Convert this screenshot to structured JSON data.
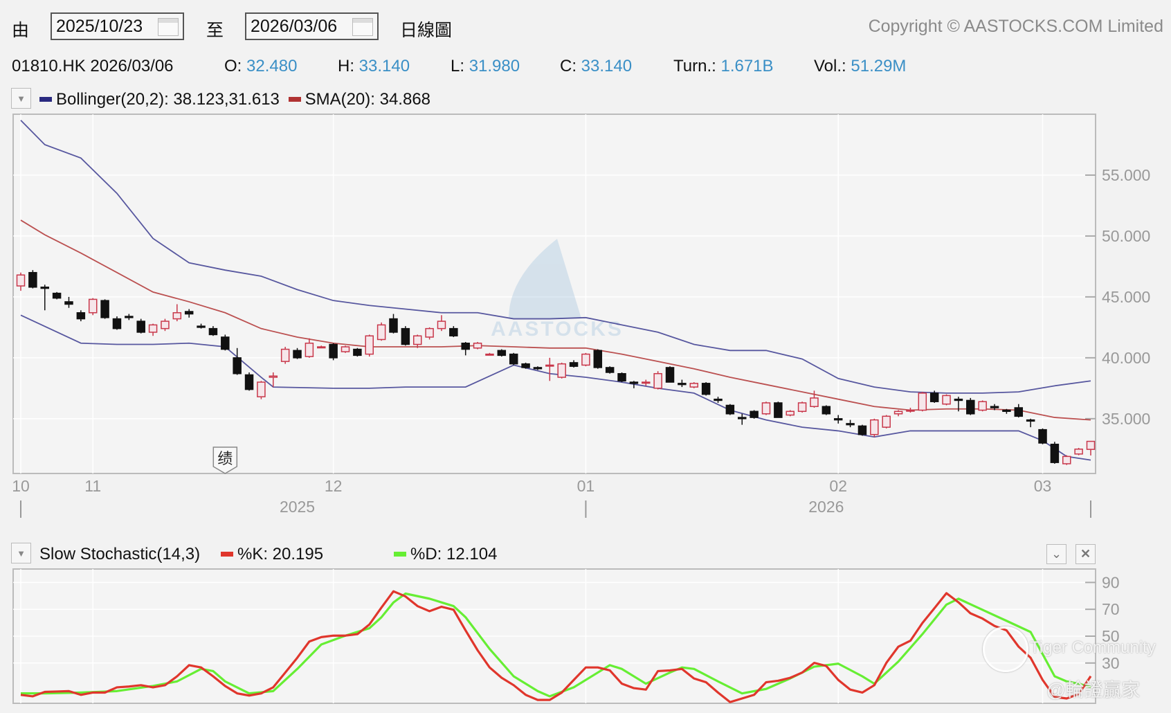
{
  "toolbar": {
    "from_label": "由",
    "from_date": "2025/10/23",
    "to_label": "至",
    "to_date": "2026/03/06",
    "chart_type": "日線圖",
    "copyright": "Copyright © AASTOCKS.COM Limited"
  },
  "quote": {
    "symbol_date": "01810.HK 2026/03/06",
    "open_label": "O:",
    "open": "32.480",
    "high_label": "H:",
    "high": "33.140",
    "low_label": "L:",
    "low": "31.980",
    "close_label": "C:",
    "close": "33.140",
    "turn_label": "Turn.:",
    "turn": "1.671B",
    "vol_label": "Vol.:",
    "vol": "51.29M"
  },
  "main_legend": {
    "bollinger": "Bollinger(20,2): 38.123,31.613",
    "sma": "SMA(20): 34.868",
    "bollinger_color": "#3b3b8f",
    "sma_color": "#b03232"
  },
  "watermark": "AASTOCKS",
  "event_marker": {
    "label": "绩",
    "index": 17
  },
  "stoch_legend": {
    "title": "Slow Stochastic(14,3)",
    "k": "%K: 20.195",
    "d": "%D: 12.104",
    "k_color": "#e0362c",
    "d_color": "#66ee33"
  },
  "overlay_watermarks": {
    "tiger": "Tiger Community",
    "author": "@輪證贏家"
  },
  "chart_data": [
    {
      "type": "candlestick",
      "title": "01810.HK Daily",
      "ylim": [
        30.5,
        60.0
      ],
      "y_ticks": [
        {
          "value": 35,
          "label": "35.000"
        },
        {
          "value": 40,
          "label": "40.000"
        },
        {
          "value": 45,
          "label": "45.000"
        },
        {
          "value": 50,
          "label": "50.000"
        },
        {
          "value": 55,
          "label": "55.000"
        }
      ],
      "month_ticks": [
        {
          "index": 0,
          "label": "10"
        },
        {
          "index": 6,
          "label": "11"
        },
        {
          "index": 26,
          "label": "12"
        },
        {
          "index": 47,
          "label": "01"
        },
        {
          "index": 68,
          "label": "02"
        },
        {
          "index": 85,
          "label": "03"
        }
      ],
      "year_ticks": [
        {
          "index": 23,
          "label": "2025"
        },
        {
          "index": 67,
          "label": "2026"
        }
      ],
      "ohlc": [
        [
          45.9,
          47.0,
          45.5,
          46.8
        ],
        [
          47.0,
          47.2,
          45.7,
          45.8
        ],
        [
          45.8,
          46.0,
          43.9,
          45.7
        ],
        [
          45.3,
          45.4,
          44.8,
          44.9
        ],
        [
          44.6,
          45.0,
          44.1,
          44.4
        ],
        [
          43.7,
          43.9,
          43.0,
          43.2
        ],
        [
          43.7,
          44.9,
          43.5,
          44.8
        ],
        [
          44.7,
          44.8,
          43.2,
          43.3
        ],
        [
          43.2,
          43.4,
          42.3,
          42.4
        ],
        [
          43.4,
          43.6,
          43.1,
          43.3
        ],
        [
          43.0,
          43.2,
          42.0,
          42.1
        ],
        [
          42.1,
          42.8,
          41.8,
          42.7
        ],
        [
          42.4,
          43.2,
          42.2,
          43.0
        ],
        [
          43.2,
          44.4,
          43.0,
          43.7
        ],
        [
          43.8,
          44.0,
          43.3,
          43.6
        ],
        [
          42.6,
          42.8,
          42.4,
          42.5
        ],
        [
          42.4,
          42.6,
          41.8,
          41.9
        ],
        [
          41.7,
          41.9,
          40.6,
          40.7
        ],
        [
          40.0,
          40.8,
          38.6,
          38.7
        ],
        [
          38.6,
          38.8,
          37.3,
          37.4
        ],
        [
          36.8,
          38.1,
          36.6,
          38.0
        ],
        [
          38.4,
          38.8,
          37.6,
          38.5
        ],
        [
          39.7,
          40.9,
          39.5,
          40.7
        ],
        [
          40.6,
          40.8,
          39.9,
          40.0
        ],
        [
          40.1,
          41.6,
          40.0,
          41.2
        ],
        [
          40.9,
          41.0,
          40.8,
          40.9
        ],
        [
          41.1,
          41.2,
          39.8,
          40.0
        ],
        [
          40.5,
          41.0,
          40.4,
          40.9
        ],
        [
          40.7,
          40.8,
          40.1,
          40.2
        ],
        [
          40.3,
          41.9,
          40.1,
          41.8
        ],
        [
          41.5,
          42.9,
          41.4,
          42.7
        ],
        [
          43.2,
          43.6,
          42.0,
          42.1
        ],
        [
          42.4,
          42.6,
          41.0,
          41.1
        ],
        [
          41.1,
          41.9,
          40.8,
          41.8
        ],
        [
          41.7,
          42.5,
          41.5,
          42.4
        ],
        [
          42.4,
          43.5,
          42.2,
          43.0
        ],
        [
          42.4,
          42.6,
          41.7,
          41.8
        ],
        [
          41.2,
          41.3,
          40.2,
          40.7
        ],
        [
          40.8,
          41.3,
          40.7,
          41.2
        ],
        [
          40.3,
          40.4,
          40.2,
          40.3
        ],
        [
          40.6,
          40.7,
          40.1,
          40.2
        ],
        [
          40.3,
          40.4,
          39.4,
          39.5
        ],
        [
          39.5,
          39.6,
          39.1,
          39.2
        ],
        [
          39.2,
          39.3,
          39.0,
          39.1
        ],
        [
          39.4,
          40.0,
          38.1,
          39.4
        ],
        [
          38.4,
          39.6,
          38.3,
          39.5
        ],
        [
          39.6,
          39.8,
          39.2,
          39.3
        ],
        [
          39.4,
          40.4,
          39.3,
          40.3
        ],
        [
          40.6,
          40.7,
          39.1,
          39.2
        ],
        [
          39.2,
          39.3,
          38.7,
          38.8
        ],
        [
          38.7,
          38.8,
          38.0,
          38.1
        ],
        [
          38.0,
          38.1,
          37.5,
          37.9
        ],
        [
          38.0,
          38.2,
          37.7,
          38.0
        ],
        [
          37.5,
          38.9,
          37.4,
          38.7
        ],
        [
          39.2,
          39.3,
          38.0,
          38.0
        ],
        [
          37.9,
          38.2,
          37.6,
          37.8
        ],
        [
          37.6,
          38.0,
          37.5,
          37.9
        ],
        [
          37.9,
          38.0,
          36.9,
          37.0
        ],
        [
          36.6,
          36.8,
          36.3,
          36.5
        ],
        [
          36.1,
          36.2,
          35.3,
          35.4
        ],
        [
          35.1,
          35.4,
          34.5,
          35.0
        ],
        [
          35.6,
          35.7,
          35.0,
          35.1
        ],
        [
          35.4,
          36.4,
          35.3,
          36.3
        ],
        [
          36.3,
          36.4,
          35.1,
          35.1
        ],
        [
          35.3,
          35.7,
          35.2,
          35.6
        ],
        [
          35.6,
          36.4,
          35.5,
          36.3
        ],
        [
          36.0,
          37.3,
          35.9,
          36.7
        ],
        [
          36.0,
          36.1,
          35.3,
          35.4
        ],
        [
          35.0,
          35.3,
          34.6,
          34.9
        ],
        [
          34.6,
          34.9,
          34.3,
          34.5
        ],
        [
          34.4,
          34.5,
          33.6,
          33.7
        ],
        [
          33.7,
          35.0,
          33.5,
          34.9
        ],
        [
          34.3,
          35.3,
          34.2,
          35.2
        ],
        [
          35.4,
          35.7,
          35.2,
          35.6
        ],
        [
          35.7,
          35.9,
          35.5,
          35.7
        ],
        [
          35.7,
          37.2,
          35.6,
          37.1
        ],
        [
          37.1,
          37.3,
          36.3,
          36.4
        ],
        [
          36.2,
          37.0,
          36.1,
          36.9
        ],
        [
          36.6,
          36.8,
          35.6,
          36.5
        ],
        [
          36.5,
          36.7,
          35.3,
          35.4
        ],
        [
          35.7,
          36.5,
          35.6,
          36.4
        ],
        [
          36.0,
          36.2,
          35.7,
          35.9
        ],
        [
          35.7,
          35.8,
          35.4,
          35.6
        ],
        [
          35.9,
          36.2,
          35.1,
          35.2
        ],
        [
          34.9,
          35.0,
          34.3,
          34.8
        ],
        [
          34.1,
          34.2,
          32.9,
          33.0
        ],
        [
          32.9,
          33.1,
          31.3,
          31.4
        ],
        [
          31.3,
          32.0,
          31.2,
          31.9
        ],
        [
          32.1,
          32.6,
          32.0,
          32.5
        ],
        [
          32.48,
          33.14,
          31.98,
          33.14
        ]
      ],
      "series": [
        {
          "name": "Bollinger Upper",
          "i": [
            0,
            2,
            5,
            8,
            11,
            14,
            17,
            20,
            23,
            26,
            29,
            32,
            35,
            38,
            41,
            44,
            47,
            50,
            53,
            56,
            59,
            62,
            65,
            68,
            71,
            74,
            77,
            80,
            83,
            86,
            89
          ],
          "values": [
            59.5,
            57.5,
            56.4,
            53.5,
            49.8,
            47.8,
            47.2,
            46.7,
            45.6,
            44.7,
            44.3,
            44.0,
            43.7,
            43.7,
            43.2,
            43.2,
            43.3,
            42.7,
            42.1,
            41.1,
            40.6,
            40.6,
            39.9,
            38.3,
            37.6,
            37.2,
            37.1,
            37.1,
            37.2,
            37.7,
            38.1
          ]
        },
        {
          "name": "Bollinger Lower",
          "i": [
            0,
            5,
            8,
            11,
            14,
            17,
            20,
            21,
            26,
            29,
            32,
            37,
            41,
            44,
            47,
            50,
            53,
            56,
            59,
            62,
            65,
            68,
            71,
            74,
            77,
            80,
            83,
            85,
            87,
            89
          ],
          "values": [
            43.5,
            41.2,
            41.1,
            41.1,
            41.2,
            40.9,
            38.4,
            37.6,
            37.5,
            37.5,
            37.6,
            37.6,
            39.4,
            38.7,
            38.4,
            38.0,
            37.5,
            37.1,
            35.7,
            34.9,
            34.3,
            34.0,
            33.5,
            34.0,
            34.0,
            34.0,
            34.0,
            33.2,
            31.9,
            31.6
          ]
        },
        {
          "name": "SMA(20)",
          "i": [
            0,
            2,
            5,
            8,
            11,
            14,
            17,
            20,
            23,
            26,
            29,
            32,
            35,
            38,
            41,
            44,
            47,
            50,
            53,
            56,
            59,
            62,
            65,
            68,
            71,
            74,
            77,
            80,
            83,
            86,
            89
          ],
          "values": [
            51.3,
            50.1,
            48.6,
            47.0,
            45.4,
            44.6,
            43.7,
            42.4,
            41.7,
            41.2,
            40.9,
            40.9,
            40.9,
            41.0,
            40.9,
            40.8,
            40.8,
            40.3,
            39.7,
            39.1,
            38.4,
            37.8,
            37.2,
            36.6,
            36.0,
            35.7,
            35.8,
            35.8,
            35.7,
            35.1,
            34.9
          ]
        }
      ]
    },
    {
      "type": "line",
      "title": "Slow Stochastic(14,3)",
      "ylim": [
        0,
        100
      ],
      "y_ticks": [
        {
          "value": 30,
          "label": "30"
        },
        {
          "value": 50,
          "label": "50"
        },
        {
          "value": 70,
          "label": "70"
        },
        {
          "value": 90,
          "label": "90"
        }
      ],
      "series": [
        {
          "name": "%K",
          "values": [
            6.3,
            5.2,
            8.5,
            8.8,
            9.1,
            6.3,
            8.0,
            8.0,
            11.9,
            12.5,
            13.5,
            11.9,
            13.5,
            20.1,
            28.4,
            26.7,
            20.1,
            12.9,
            7.4,
            5.8,
            7.4,
            11.9,
            22.9,
            33.9,
            46.0,
            49.3,
            50.4,
            50.4,
            51.5,
            58.7,
            71.3,
            83.4,
            79.6,
            72.4,
            68.6,
            71.9,
            69.7,
            54.3,
            39.5,
            26.7,
            19.0,
            13.5,
            6.3,
            2.5,
            2.5,
            8.0,
            17.4,
            26.7,
            26.7,
            24.5,
            14.6,
            11.3,
            10.2,
            24.0,
            24.5,
            25.6,
            18.5,
            15.7,
            8.0,
            0.9,
            3.6,
            6.3,
            15.7,
            16.8,
            19.0,
            22.9,
            30.1,
            27.8,
            17.4,
            10.2,
            8.0,
            13.5,
            30.1,
            42.2,
            46.6,
            59.8,
            70.8,
            82.0,
            75.2,
            67.0,
            63.1,
            57.6,
            54.3,
            42.2,
            33.9,
            17.4,
            4.7,
            3.6,
            6.9,
            20.2
          ]
        },
        {
          "name": "%D",
          "i": [
            0,
            2,
            5,
            8,
            11,
            13,
            15,
            16,
            17,
            19,
            21,
            23,
            25,
            27,
            29,
            30,
            31,
            32,
            34,
            36,
            37,
            39,
            41,
            43,
            44,
            46,
            48,
            49,
            50,
            52,
            54,
            55,
            56,
            58,
            60,
            62,
            64,
            66,
            68,
            70,
            71,
            73,
            75,
            77,
            78,
            80,
            82,
            84,
            85,
            86,
            87,
            88,
            89
          ],
          "values": [
            7.4,
            7.4,
            8.0,
            9.1,
            12.9,
            16.3,
            25.6,
            24.0,
            16.3,
            7.4,
            9.1,
            25.6,
            43.8,
            50.4,
            55.9,
            64.1,
            75.1,
            81.7,
            77.9,
            72.4,
            64.1,
            40.5,
            20.1,
            9.1,
            5.2,
            11.9,
            22.9,
            28.4,
            25.6,
            14.6,
            22.9,
            26.7,
            25.6,
            16.3,
            7.4,
            10.7,
            18.5,
            27.3,
            29.5,
            20.1,
            14.6,
            31.1,
            51.5,
            73.5,
            77.9,
            69.6,
            61.4,
            53.1,
            36.6,
            20.1,
            16.3,
            14.6,
            12.1
          ]
        }
      ]
    }
  ]
}
